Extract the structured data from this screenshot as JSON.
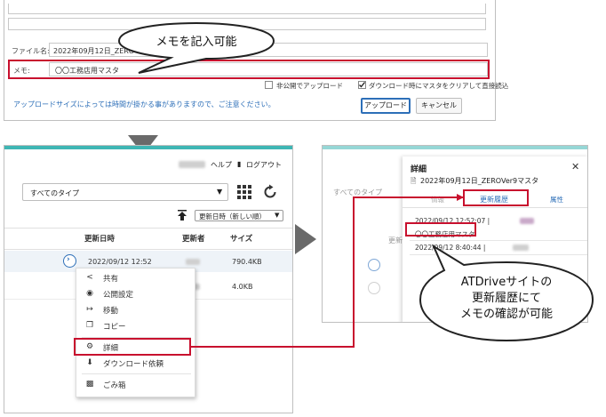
{
  "upload_dialog": {
    "filename_label": "ファイル名:",
    "filename_value": "2022年09月12日_ZERO",
    "memo_label": "メモ:",
    "memo_value": "〇〇工務店用マスタ",
    "checkbox_private": "非公開でアップロード",
    "checkbox_clear": "ダウンロード時にマスタをクリアして直接読込",
    "notice": "アップロードサイズによっては時間が掛かる事がありますので、ご注意ください。",
    "upload_button": "アップロード",
    "cancel_button": "キャンセル"
  },
  "callout_top": "メモを記入可能",
  "file_list": {
    "help_link": "ヘルプ",
    "logout_link": "ログアウト",
    "type_filter": "すべてのタイプ",
    "sort_select": "更新日時（新しい順）",
    "columns": [
      "更新日時",
      "更新者",
      "サイズ"
    ],
    "rows": [
      {
        "updated": "2022/09/12 12:52",
        "size": "790.4KB"
      },
      {
        "updated": "",
        "size": "4.0KB"
      }
    ],
    "context_menu": [
      {
        "label": "共有",
        "icon": "share-icon"
      },
      {
        "label": "公開設定",
        "icon": "globe-icon"
      },
      {
        "label": "移動",
        "icon": "move-icon"
      },
      {
        "label": "コピー",
        "icon": "copy-icon"
      },
      {
        "label": "詳細",
        "icon": "gear-icon"
      },
      {
        "label": "ダウンロード依頼",
        "icon": "download-icon"
      },
      {
        "label": "ごみ箱",
        "icon": "trash-icon"
      }
    ]
  },
  "detail_panel": {
    "title": "詳細",
    "file_name": "2022年09月12日_ZEROVer9マスタ",
    "tab_info": "情報",
    "tab_history": "更新履歴",
    "tab_attr": "属性",
    "history": [
      {
        "time": "2022/09/12 12:52:07 |",
        "memo": "〇〇工務店用マスタ"
      },
      {
        "time": "2022/09/12 8:40:44 |",
        "memo": ""
      }
    ],
    "bg_filter": "すべてのタイプ",
    "bg_header": "更新"
  },
  "callout_bottom": [
    "ATDriveサイトの",
    "更新履歴にて",
    "メモの確認が可能"
  ],
  "colors": {
    "highlight": "#c8102e",
    "teal": "#3fb6b4",
    "link_blue": "#2d6fb8"
  }
}
